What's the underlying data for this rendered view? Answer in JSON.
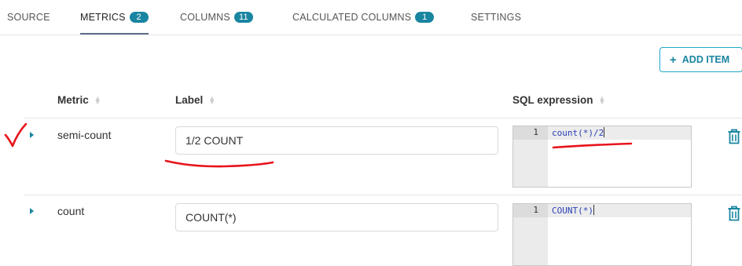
{
  "tabs": [
    {
      "label": "SOURCE",
      "badge": null,
      "active": false
    },
    {
      "label": "METRICS",
      "badge": "2",
      "active": true
    },
    {
      "label": "COLUMNS",
      "badge": "11",
      "active": false
    },
    {
      "label": "CALCULATED COLUMNS",
      "badge": "1",
      "active": false
    },
    {
      "label": "SETTINGS",
      "badge": null,
      "active": false
    }
  ],
  "toolbar": {
    "add_item_label": "ADD ITEM",
    "add_icon": "plus-icon"
  },
  "table": {
    "columns": [
      "Metric",
      "Label",
      "SQL expression"
    ],
    "rows": [
      {
        "metric": "semi-count",
        "label": "1/2 COUNT",
        "line_number": "1",
        "sql": "count(*)/2"
      },
      {
        "metric": "count",
        "label": "COUNT(*)",
        "line_number": "1",
        "sql": "COUNT(*)"
      }
    ]
  },
  "icons": {
    "expand": "caret-right-icon",
    "delete": "trash-icon",
    "sort": "sort-icon"
  },
  "colors": {
    "accent": "#1a85a0",
    "badge": "#1a85a0",
    "annotation": "#e8141c"
  }
}
